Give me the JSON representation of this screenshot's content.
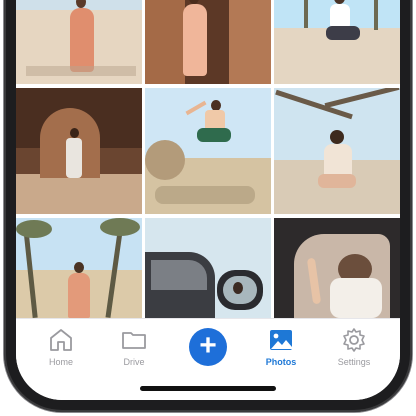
{
  "tabbar": {
    "items": [
      {
        "label": "Home",
        "icon": "home-icon"
      },
      {
        "label": "Drive",
        "icon": "folder-icon"
      },
      {
        "label": "",
        "icon": "plus-icon"
      },
      {
        "label": "Photos",
        "icon": "image-icon"
      },
      {
        "label": "Settings",
        "icon": "gear-icon"
      }
    ],
    "active": "Photos",
    "accent_color": "#1e78d6",
    "inactive_color": "#9a9a9f"
  },
  "gallery": {
    "photos": [
      {
        "name": "photo-woman-floral-dress-desert",
        "palette": [
          "#cfe0ea",
          "#e8c9b4",
          "#e39a7a"
        ]
      },
      {
        "name": "photo-woman-dress-canyon",
        "palette": [
          "#9a6040",
          "#c88a66",
          "#f0b69a"
        ]
      },
      {
        "name": "photo-woman-sitting-joshua-tree",
        "palette": [
          "#bfe3f5",
          "#e8dccb",
          "#ffffff"
        ]
      },
      {
        "name": "photo-woman-walking-cave",
        "palette": [
          "#5a3a28",
          "#a36e4c",
          "#e9d8c4"
        ]
      },
      {
        "name": "photo-woman-jumping-desert",
        "palette": [
          "#cfe6f5",
          "#d9c8a8",
          "#2f6b4d"
        ]
      },
      {
        "name": "photo-woman-tree-branches",
        "palette": [
          "#cfe4f0",
          "#d9cbb6",
          "#f1e4d6"
        ]
      },
      {
        "name": "photo-woman-joshua-trees",
        "palette": [
          "#c7e2f3",
          "#d7c3a4",
          "#e39a7a"
        ]
      },
      {
        "name": "photo-woman-car-mirror",
        "palette": [
          "#d6e6ee",
          "#7b7f85",
          "#3b3d42"
        ]
      },
      {
        "name": "photo-woman-car-window",
        "palette": [
          "#2d2a2b",
          "#c9b7a8",
          "#f3efe9"
        ]
      }
    ]
  }
}
